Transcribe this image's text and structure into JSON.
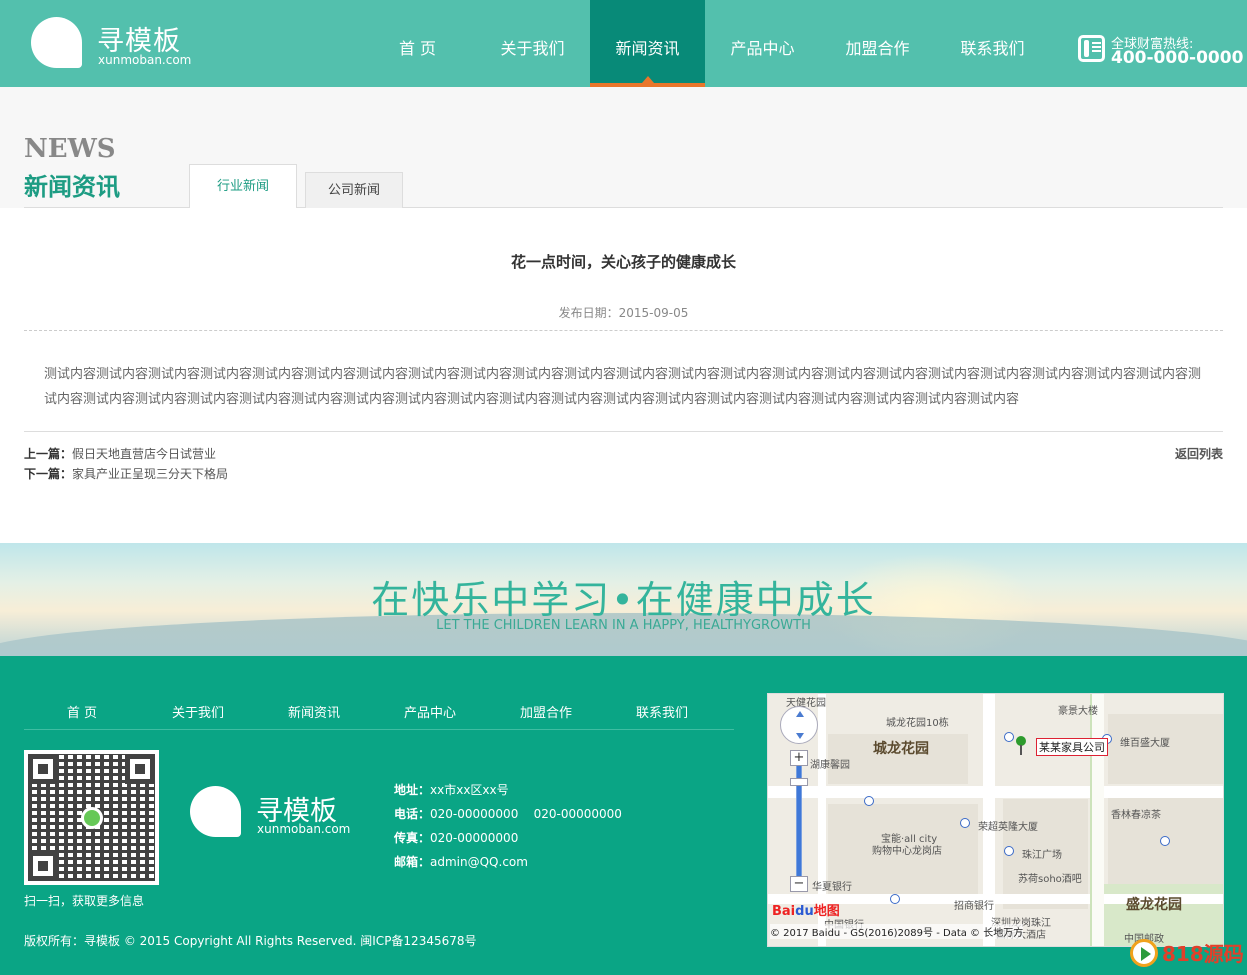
{
  "header": {
    "logo_name": "寻模板",
    "logo_sub": "xunmoban.com",
    "nav": [
      "首 页",
      "关于我们",
      "新闻资讯",
      "产品中心",
      "加盟合作",
      "联系我们"
    ],
    "active_nav": "新闻资讯",
    "hotline_label": "全球财富热线:",
    "hotline_number": "400-000-0000"
  },
  "section": {
    "title_en": "NEWS",
    "title_cn": "新闻资讯",
    "tabs": [
      "行业新闻",
      "公司新闻"
    ]
  },
  "article": {
    "title": "花一点时间，关心孩子的健康成长",
    "date": "发布日期：2015-09-05",
    "body": "测试内容测试内容测试内容测试内容测试内容测试内容测试内容测试内容测试内容测试内容测试内容测试内容测试内容测试内容测试内容测试内容测试内容测试内容测试内容测试内容测试内容测试内容测试内容测试内容测试内容测试内容测试内容测试内容测试内容测试内容测试内容测试内容测试内容测试内容测试内容测试内容测试内容测试内容测试内容测试内容测试内容",
    "prev_label": "上一篇：",
    "prev_title": "假日天地直营店今日试营业",
    "next_label": "下一篇：",
    "next_title": "家具产业正呈现三分天下格局",
    "back_label": "返回列表"
  },
  "banner": {
    "slogan_cn": "在快乐中学习•在健康中成长",
    "slogan_en": "LET THE CHILDREN LEARN IN A HAPPY, HEALTHYGROWTH"
  },
  "footer": {
    "nav": [
      "首 页",
      "关于我们",
      "新闻资讯",
      "产品中心",
      "加盟合作",
      "联系我们"
    ],
    "qr_caption": "扫一扫，获取更多信息",
    "logo_name": "寻模板",
    "logo_sub": "xunmoban.com",
    "address_label": "地址：",
    "address": "xx市xx区xx号",
    "phone_label": "电话：",
    "phone": "020-00000000    020-00000000",
    "fax_label": "传真：",
    "fax": "020-00000000",
    "email_label": "邮箱：",
    "email": "admin@QQ.com",
    "copyright": "版权所有：寻模板 © 2015 Copyright  All Rights Reserved. 闽ICP备12345678号"
  },
  "map": {
    "company": "某某家具公司",
    "labels": [
      "天健花园",
      "城龙花园10栋",
      "豪景大楼",
      "城龙花园",
      "湖康馨园",
      "维百盛大厦",
      "荣超英隆大厦",
      "香林春凉茶",
      "宝能·all city",
      "购物中心龙岗店",
      "珠江广场",
      "苏荷soho酒吧",
      "华夏银行",
      "招商银行",
      "盛龙花园",
      "中国银行",
      "深圳龙岗珠江",
      "国际大酒店",
      "中国邮政"
    ],
    "brand_red": "Bai",
    "brand_blue": "du",
    "brand_suffix": "地图",
    "zoom_in": "+",
    "zoom_out": "−",
    "attribution": "© 2017 Baidu - GS(2016)2089号 - Data © 长地万方"
  },
  "watermark": "818源码"
}
